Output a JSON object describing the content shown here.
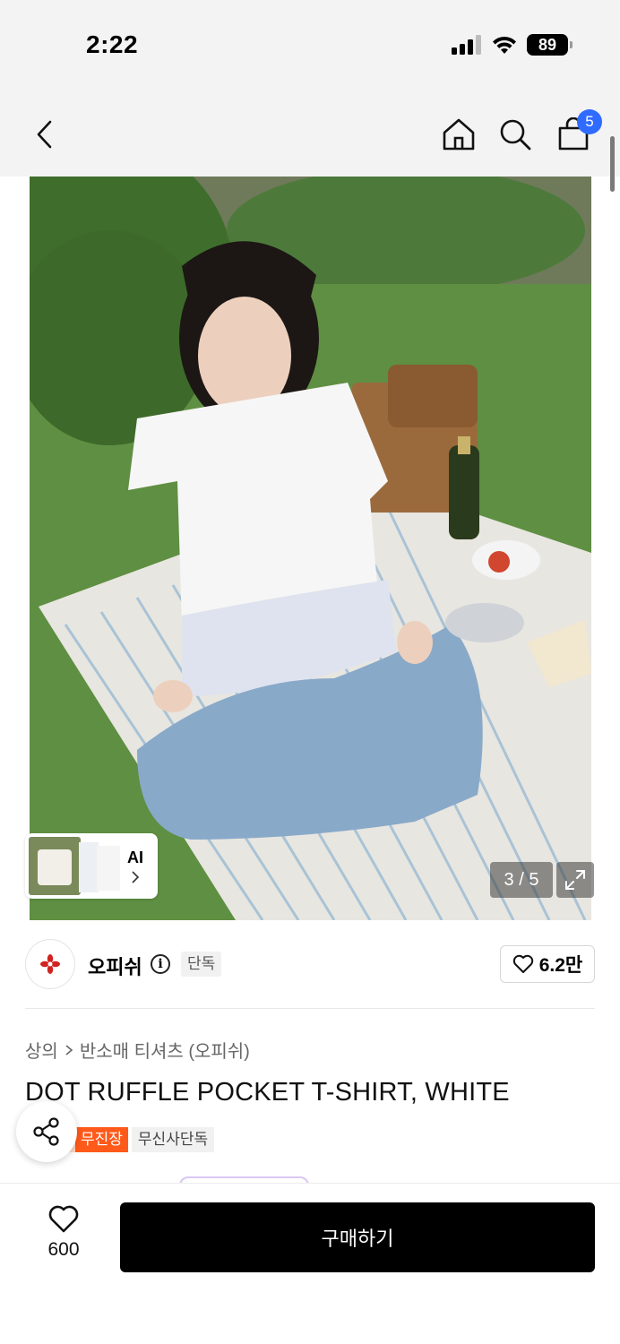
{
  "status_bar": {
    "time": "2:22",
    "battery": "89"
  },
  "nav": {
    "cart_count": "5"
  },
  "gallery": {
    "counter": "3 / 5",
    "ai_label": "AI"
  },
  "brand": {
    "name": "오피쉬",
    "info_symbol": "i",
    "tag": "단독",
    "likes": "6.2만"
  },
  "breadcrumb": {
    "category": "상의",
    "subcategory": "반소매 티셔츠 (오피쉬)"
  },
  "product": {
    "title": "DOT RUFFLE POCKET T-SHIRT, WHITE"
  },
  "tags": [
    {
      "label": "무진장",
      "color": "#ff5a1a"
    },
    {
      "label": "무신사단독"
    }
  ],
  "bottom_bar": {
    "wish_count": "600",
    "buy_label": "구매하기"
  },
  "colors": {
    "accent_blue": "#2f6bff",
    "buy_button": "#000000",
    "tag_orange": "#ff5a1a"
  }
}
